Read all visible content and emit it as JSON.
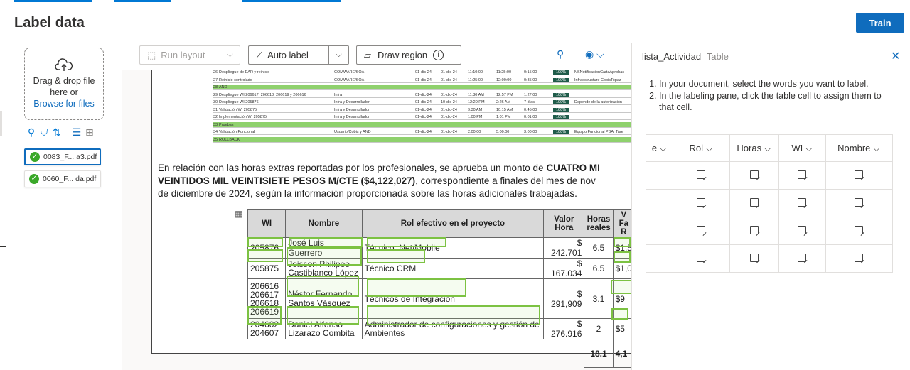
{
  "header": {
    "title": "Label data",
    "train_label": "Train"
  },
  "left": {
    "drop_text_1": "Drag & drop file",
    "drop_text_2": "here or",
    "browse_link": "Browse for files",
    "files": [
      {
        "name": "0083_F... a3.pdf",
        "status": "labeled",
        "selected": true
      },
      {
        "name": "0060_F... da.pdf",
        "status": "labeled",
        "selected": false
      }
    ]
  },
  "toolbar": {
    "run_layout": "Run layout",
    "auto_label": "Auto label",
    "draw_region": "Draw region"
  },
  "document": {
    "mini_rows": [
      {
        "n": "26",
        "task": "Despliegue de EAR y reinicio",
        "area": "COMWARE/SOA",
        "d1": "01-dic-24",
        "d2": "01-dic-24",
        "t1": "11:10:00",
        "t2": "11:25:00",
        "t3": "0:15:00",
        "pct": "100%",
        "note": "NSNotificacionCartaAprobac"
      },
      {
        "n": "27",
        "task": "Reinicio controlado",
        "area": "COMWARE/SOA",
        "d1": "01-dic-24",
        "d2": "01-dic-24",
        "t1": "11:25:00",
        "t2": "12:00:00",
        "t3": "0:35:00",
        "pct": "100%",
        "note": "Infraestructure CobisTopaz"
      },
      {
        "n": "28",
        "task": "AND",
        "green": true
      },
      {
        "n": "29",
        "task": "Despliegue WI 206617, 206618, 206619 y 206616",
        "area": "Infra",
        "d1": "01-dic-24",
        "d2": "01-dic-24",
        "t1": "11:30 AM",
        "t2": "12:57 PM",
        "t3": "1:27:00",
        "pct": "100%",
        "note": ""
      },
      {
        "n": "30",
        "task": "Despliegue WI 205876",
        "area": "Infra y Desarrollador",
        "d1": "01-dic-24",
        "d2": "10-dic-24",
        "t1": "12:20 PM",
        "t2": "2:26 AM",
        "t3": "7 días",
        "pct": "100%",
        "note": "Depende de la autorización"
      },
      {
        "n": "31",
        "task": "Validación WI 205875",
        "area": "Infra y Desarrollador",
        "d1": "01-dic-24",
        "d2": "01-dic-24",
        "t1": "9:30 AM",
        "t2": "10:15 AM",
        "t3": "0:45:00",
        "pct": "100%",
        "note": ""
      },
      {
        "n": "32",
        "task": "Implementación WI 205875",
        "area": "Infra y Desarrollador",
        "d1": "01-dic-24",
        "d2": "01-dic-24",
        "t1": "1:00 PM",
        "t2": "1:01 PM",
        "t3": "0:01:00",
        "pct": "100%",
        "note": ""
      },
      {
        "n": "33",
        "task": "Pruebas",
        "green": true
      },
      {
        "n": "34",
        "task": "Validación Funcional",
        "area": "Usuario/Cobis y AND",
        "d1": "01-dic-24",
        "d2": "01-dic-24",
        "t1": "2:00:00",
        "t2": "5:00:00",
        "t3": "3:00:00",
        "pct": "100%",
        "note": "Equipo Funcional PBA. Tare"
      },
      {
        "n": "35",
        "task": "ROLLBACK",
        "green": true
      }
    ],
    "para_1_normal": "En relación con las horas extras reportadas por los profesionales, se aprueba un monto de ",
    "para_1_bold": "CUATRO MI",
    "para_2_bold": "VEINTIDOS MIL VEINTISIETE PESOS M/CTE ($4,122,027)",
    "para_2_normal": ", correspondiente a finales del mes de nov",
    "para_3": "de diciembre de 2024, según la información proporcionada sobre las horas adicionales trabajadas.",
    "table_headers": [
      "WI",
      "Nombre",
      "Rol efectivo en el proyecto",
      "Valor Hora",
      "Horas reales",
      "V Fa R"
    ],
    "table_rows": [
      {
        "wi": "205876",
        "nombre": "José Luis Guerrero",
        "rol": "Técnico .Net/Mobile",
        "valor": "$ 242.701",
        "horas": "6.5",
        "fa": "$1,5"
      },
      {
        "wi": "205875",
        "nombre": "Jeisson Philipee Castiblanco López",
        "rol": "Técnico CRM",
        "valor": "$ 167.034",
        "horas": "6.5",
        "fa": "$1,0"
      },
      {
        "wi": "206616 206617 206618 206619",
        "nombre": "Néstor Fernando Santos Vásquez",
        "rol": "Técnicos de Integración",
        "valor": "$ 291,909",
        "horas": "3.1",
        "fa": "$9"
      },
      {
        "wi": "204602 204607",
        "nombre": "Daniel Alfonso Lizarazo Combita",
        "rol": "Administrador de configuraciones y gestión de Ambientes",
        "valor": "$ 276.916",
        "horas": "2",
        "fa": "$5"
      }
    ],
    "table_total_horas": "18.1",
    "table_total_fa": "4,1"
  },
  "right_panel": {
    "field_name": "lista_Actividad",
    "field_type": "Table",
    "instructions": [
      "In your document, select the words you want to label.",
      "In the labeling pane, click the table cell to assign them to that cell."
    ],
    "columns": [
      "e",
      "Rol",
      "Horas",
      "WI",
      "Nombre"
    ],
    "row_count": 4
  }
}
